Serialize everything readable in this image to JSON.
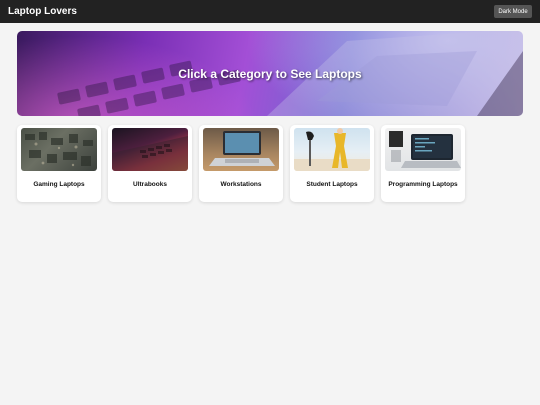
{
  "header": {
    "brand": "Laptop Lovers",
    "dark_mode_label": "Dark Mode"
  },
  "hero": {
    "title": "Click a Category to See Laptops"
  },
  "categories": [
    {
      "label": "Gaming Laptops",
      "image": "gaming-laptops-photo"
    },
    {
      "label": "Ultrabooks",
      "image": "ultrabooks-photo"
    },
    {
      "label": "Workstations",
      "image": "workstations-photo"
    },
    {
      "label": "Student Laptops",
      "image": "student-laptops-photo"
    },
    {
      "label": "Programming Laptops",
      "image": "programming-laptops-photo"
    }
  ],
  "colors": {
    "topbar": "#222222",
    "background": "#f4f4f4",
    "button": "#555555"
  }
}
